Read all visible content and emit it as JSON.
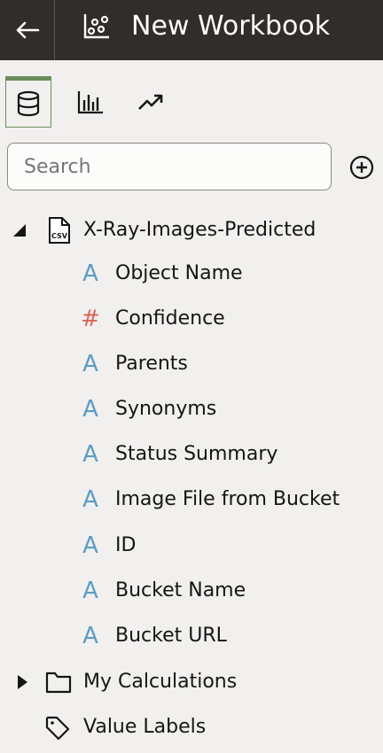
{
  "header": {
    "title": "New Workbook"
  },
  "tabs": [
    {
      "name": "data",
      "icon": "database-icon",
      "active": true
    },
    {
      "name": "visualizations",
      "icon": "bar-chart-icon",
      "active": false
    },
    {
      "name": "analytics",
      "icon": "trend-arrow-icon",
      "active": false
    }
  ],
  "search": {
    "placeholder": "Search"
  },
  "dataset": {
    "name": "X-Ray-Images-Predicted",
    "icon_text": "CSV",
    "expanded": true,
    "columns": [
      {
        "label": "Object Name",
        "type": "A"
      },
      {
        "label": "Confidence",
        "type": "#"
      },
      {
        "label": "Parents",
        "type": "A"
      },
      {
        "label": "Synonyms",
        "type": "A"
      },
      {
        "label": "Status Summary",
        "type": "A"
      },
      {
        "label": "Image File from Bucket",
        "type": "A"
      },
      {
        "label": "ID",
        "type": "A"
      },
      {
        "label": "Bucket Name",
        "type": "A"
      },
      {
        "label": "Bucket URL",
        "type": "A"
      }
    ]
  },
  "my_calculations": {
    "label": "My Calculations",
    "expanded": false
  },
  "value_labels": {
    "label": "Value Labels"
  },
  "colors": {
    "header_bg": "#312d2a",
    "text_attr": "#5d9cc4",
    "numeric_attr": "#d9655a",
    "active_tab": "#6b8f5c"
  }
}
